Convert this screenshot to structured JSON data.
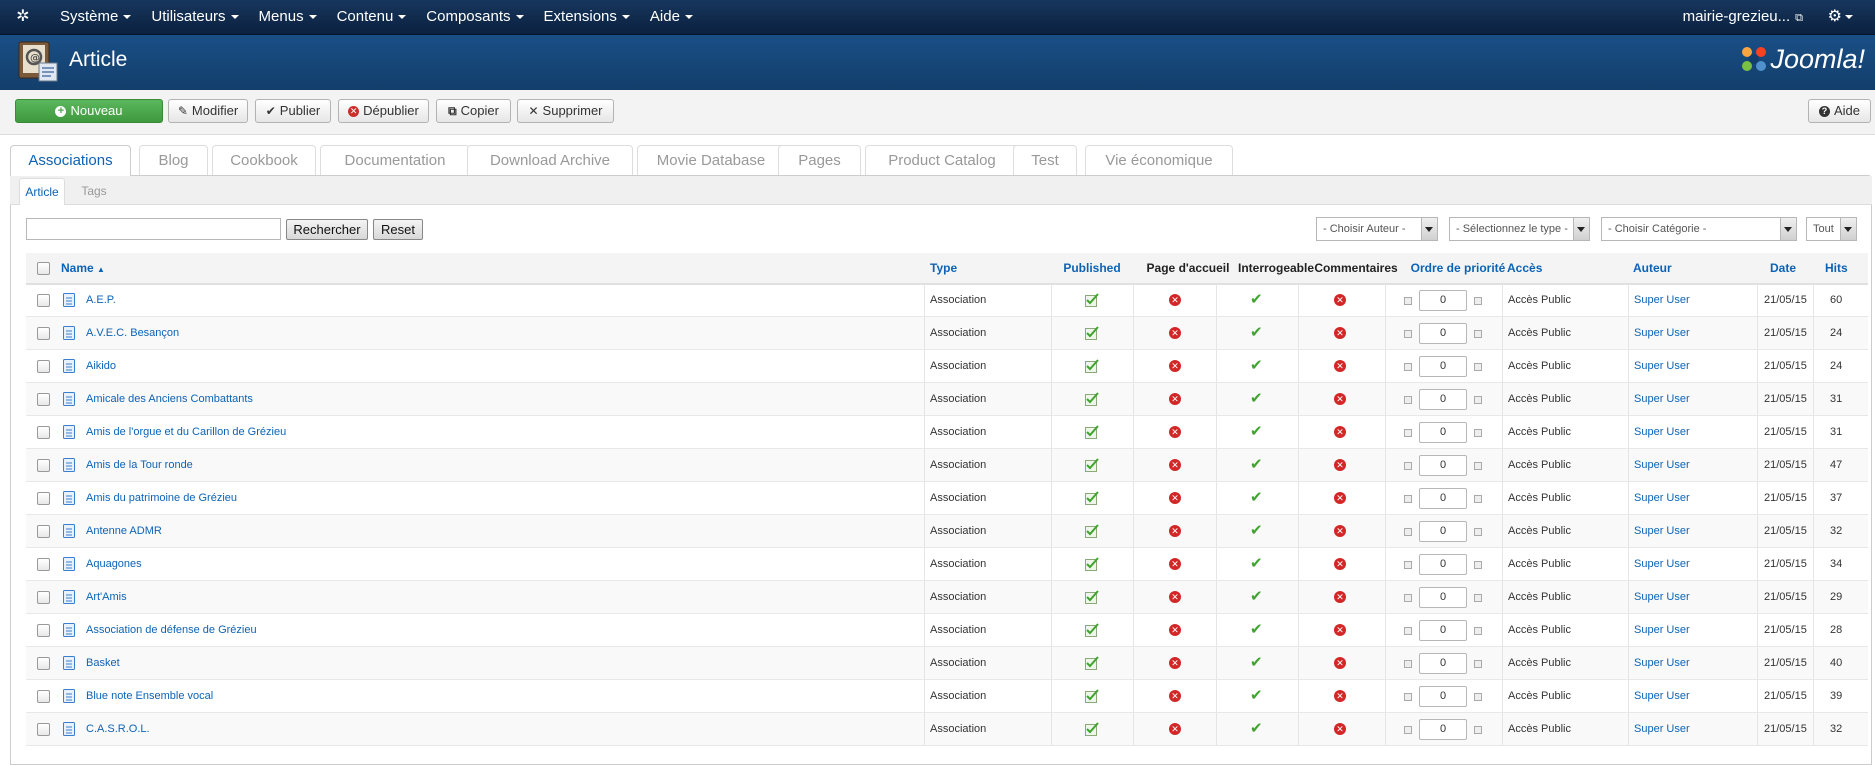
{
  "navbar": {
    "menu": [
      "Système",
      "Utilisateurs",
      "Menus",
      "Contenu",
      "Composants",
      "Extensions",
      "Aide"
    ],
    "site_link": "mairie-grezieu..."
  },
  "header": {
    "title": "Article",
    "brand": "Joomla!"
  },
  "toolbar": {
    "new": "Nouveau",
    "edit": "Modifier",
    "publish": "Publier",
    "unpublish": "Dépublier",
    "copy": "Copier",
    "delete": "Supprimer",
    "help": "Aide"
  },
  "tabs": [
    "Associations",
    "Blog",
    "Cookbook",
    "Documentation",
    "Download Archive",
    "Movie Database",
    "Pages",
    "Product Catalog",
    "Test",
    "Vie économique"
  ],
  "subtabs": [
    "Article",
    "Tags"
  ],
  "filters": {
    "search_value": "",
    "search_button": "Rechercher",
    "reset_button": "Reset",
    "author": "- Choisir Auteur -",
    "type": "- Sélectionnez le type -",
    "category": "- Choisir Catégorie -",
    "limit": "Tout"
  },
  "columns": {
    "name": "Name",
    "type": "Type",
    "published": "Published",
    "home": "Page d'accueil",
    "searchable": "Interrogeable",
    "comments": "Commentaires",
    "priority": "Ordre de priorité",
    "access": "Accès",
    "author": "Auteur",
    "date": "Date",
    "hits": "Hits"
  },
  "rows": [
    {
      "name": "A.E.P.",
      "type": "Association",
      "order": "0",
      "access": "Accès Public",
      "author": "Super User",
      "date": "21/05/15",
      "hits": "60"
    },
    {
      "name": "A.V.E.C. Besançon",
      "type": "Association",
      "order": "0",
      "access": "Accès Public",
      "author": "Super User",
      "date": "21/05/15",
      "hits": "24"
    },
    {
      "name": "Aikido",
      "type": "Association",
      "order": "0",
      "access": "Accès Public",
      "author": "Super User",
      "date": "21/05/15",
      "hits": "24"
    },
    {
      "name": "Amicale des Anciens Combattants",
      "type": "Association",
      "order": "0",
      "access": "Accès Public",
      "author": "Super User",
      "date": "21/05/15",
      "hits": "31"
    },
    {
      "name": "Amis de l'orgue et du Carillon de Grézieu",
      "type": "Association",
      "order": "0",
      "access": "Accès Public",
      "author": "Super User",
      "date": "21/05/15",
      "hits": "31"
    },
    {
      "name": "Amis de la Tour ronde",
      "type": "Association",
      "order": "0",
      "access": "Accès Public",
      "author": "Super User",
      "date": "21/05/15",
      "hits": "47"
    },
    {
      "name": "Amis du patrimoine de Grézieu",
      "type": "Association",
      "order": "0",
      "access": "Accès Public",
      "author": "Super User",
      "date": "21/05/15",
      "hits": "37"
    },
    {
      "name": "Antenne ADMR",
      "type": "Association",
      "order": "0",
      "access": "Accès Public",
      "author": "Super User",
      "date": "21/05/15",
      "hits": "32"
    },
    {
      "name": "Aquagones",
      "type": "Association",
      "order": "0",
      "access": "Accès Public",
      "author": "Super User",
      "date": "21/05/15",
      "hits": "34"
    },
    {
      "name": "Art'Amis",
      "type": "Association",
      "order": "0",
      "access": "Accès Public",
      "author": "Super User",
      "date": "21/05/15",
      "hits": "29"
    },
    {
      "name": "Association de défense de Grézieu",
      "type": "Association",
      "order": "0",
      "access": "Accès Public",
      "author": "Super User",
      "date": "21/05/15",
      "hits": "28"
    },
    {
      "name": "Basket",
      "type": "Association",
      "order": "0",
      "access": "Accès Public",
      "author": "Super User",
      "date": "21/05/15",
      "hits": "40"
    },
    {
      "name": "Blue note Ensemble vocal",
      "type": "Association",
      "order": "0",
      "access": "Accès Public",
      "author": "Super User",
      "date": "21/05/15",
      "hits": "39"
    },
    {
      "name": "C.A.S.R.O.L.",
      "type": "Association",
      "order": "0",
      "access": "Accès Public",
      "author": "Super User",
      "date": "21/05/15",
      "hits": "32"
    }
  ]
}
